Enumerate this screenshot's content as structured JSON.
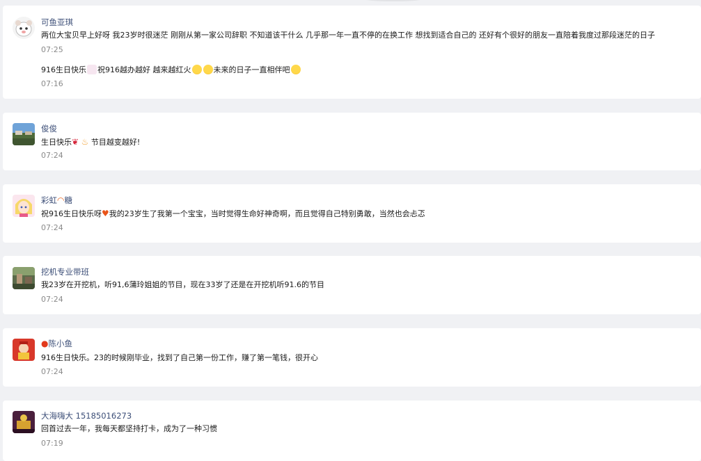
{
  "comments": [
    {
      "user": "可鱼亚琪",
      "avatar_icon": "cartoon-cat-avatar",
      "message": "两位大宝贝早上好呀 我23岁时很迷茫 刚刚从第一家公司辞职 不知道该干什么 几乎那一年一直不停的在换工作 想找到适合自己的 还好有个很好的朋友一直陪着我度过那段迷茫的日子",
      "time": "07:25",
      "second_message_parts": [
        "916生日快乐",
        "祝916越办越好 越来越红火",
        "未来的日子一直相伴吧"
      ],
      "second_time": "07:16"
    },
    {
      "user": "俊俊",
      "avatar_icon": "landscape-photo-avatar",
      "message_parts": [
        "生日快乐",
        "节目越变越好!"
      ],
      "time": "07:24"
    },
    {
      "user_parts": [
        "彩虹",
        "糖"
      ],
      "avatar_icon": "anime-girl-avatar",
      "message_parts": [
        "祝916生日快乐呀",
        "我的23岁生了我第一个宝宝，当时觉得生命好神奇啊，而且觉得自己特别勇敢，当然也会忐忑"
      ],
      "time": "07:24"
    },
    {
      "user": "挖机专业带班",
      "avatar_icon": "outdoor-photo-avatar",
      "message": "我23岁在开挖机，听91,6蒲玲姐姐的节目，现在33岁了还是在开挖机听91.6的节目",
      "time": "07:24"
    },
    {
      "user": "陈小鱼",
      "avatar_icon": "red-festive-avatar",
      "message": "916生日快乐。23的时候刚毕业，找到了自己第一份工作，赚了第一笔钱，很开心",
      "time": "07:24"
    },
    {
      "user": "大海嗨大 15185016273",
      "avatar_icon": "purple-gold-avatar",
      "message": "回首过去一年，我每天都坚持打卡，成为了一种习惯",
      "time": "07:19"
    }
  ]
}
